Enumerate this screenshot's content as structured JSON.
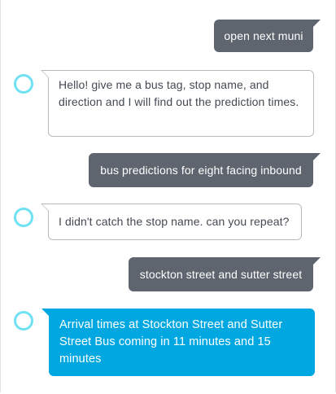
{
  "conversation": {
    "messages": [
      {
        "sender": "user",
        "text": "open next muni"
      },
      {
        "sender": "alexa",
        "text": "Hello! give me a bus tag, stop name, and direction and I will find out the prediction times."
      },
      {
        "sender": "user",
        "text": "bus predictions for eight facing inbound"
      },
      {
        "sender": "alexa",
        "text": "I didn't catch the stop name. can you repeat?"
      },
      {
        "sender": "user",
        "text": "stockton street and sutter street"
      },
      {
        "sender": "alexa",
        "text": "Arrival times at Stockton Street and Sutter Street Bus coming in 11 minutes and 15 minutes"
      }
    ]
  },
  "theme": {
    "user_bubble_color": "#5e656e",
    "alexa_bubble_border": "#b8bcc0",
    "alexa_latest_bubble_color": "#00a7e1",
    "alexa_icon_color": "#6fe1f2",
    "alexa_icon": "alexa-ring-icon"
  }
}
